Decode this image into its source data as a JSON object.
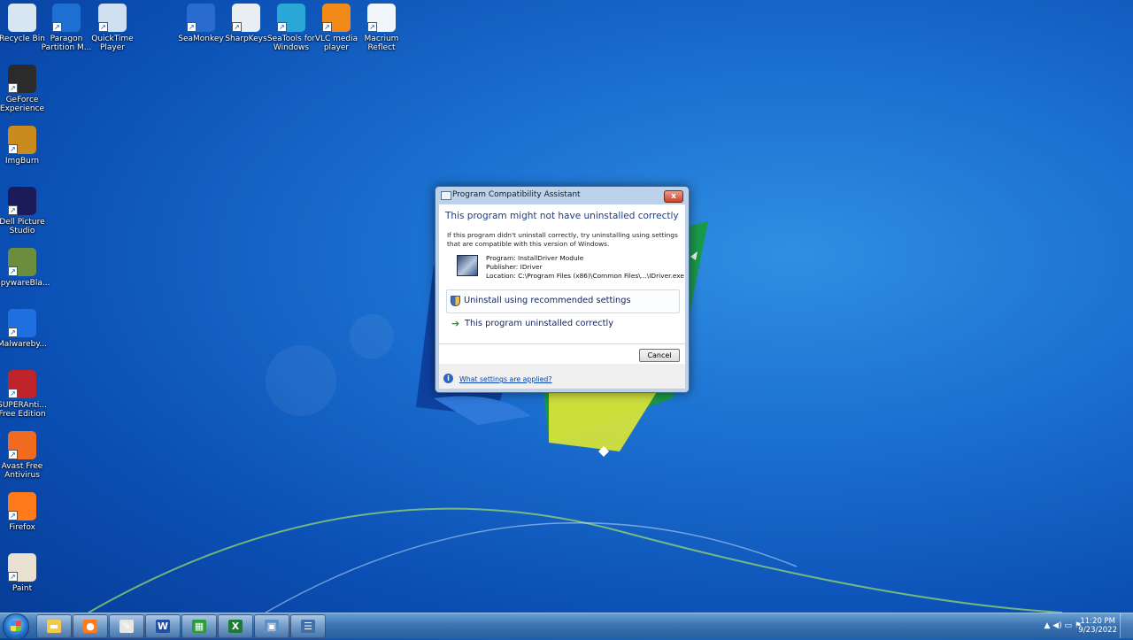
{
  "desktop": {
    "icons": [
      {
        "label": "Recycle Bin",
        "icon": "recycle-bin-icon"
      },
      {
        "label": "Paragon Partition M...",
        "icon": "paragon-icon"
      },
      {
        "label": "QuickTime Player",
        "icon": "quicktime-icon"
      },
      {
        "label": "SeaMonkey",
        "icon": "seamonkey-icon"
      },
      {
        "label": "SharpKeys",
        "icon": "sharpkeys-icon"
      },
      {
        "label": "SeaTools for Windows",
        "icon": "seatools-icon"
      },
      {
        "label": "VLC media player",
        "icon": "vlc-icon"
      },
      {
        "label": "Macrium Reflect",
        "icon": "macrium-icon"
      },
      {
        "label": "GeForce Experience",
        "icon": "geforce-icon"
      },
      {
        "label": "ImgBurn",
        "icon": "imgburn-icon"
      },
      {
        "label": "Dell Picture Studio",
        "icon": "dell-picture-studio-icon"
      },
      {
        "label": "SpywareBla...",
        "icon": "spywareblaster-icon"
      },
      {
        "label": "Malwareby...",
        "icon": "malwarebytes-icon"
      },
      {
        "label": "SUPERAnti... Free Edition",
        "icon": "superantispyware-icon"
      },
      {
        "label": "Avast Free Antivirus",
        "icon": "avast-icon"
      },
      {
        "label": "Firefox",
        "icon": "firefox-icon"
      },
      {
        "label": "Paint",
        "icon": "paint-icon"
      }
    ]
  },
  "dialog": {
    "title": "Program Compatibility Assistant",
    "close_glyph": "x",
    "heading": "This program might not have uninstalled correctly",
    "description": "If this program didn't uninstall correctly, try uninstalling using settings that are compatible with this version of Windows.",
    "program": "Program: InstallDriver Module",
    "publisher": "Publisher: IDriver",
    "location": "Location: C:\\Program Files (x86)\\Common Files\\...\\IDriver.exe",
    "option_recommended": "Uninstall using recommended settings",
    "option_correct": "This program uninstalled correctly",
    "cancel_label": "Cancel",
    "info_glyph": "i",
    "settings_link": "What settings are applied?"
  },
  "taskbar": {
    "pinned": [
      {
        "icon": "explorer-icon",
        "glyph": "▬",
        "color": "#f2c94c"
      },
      {
        "icon": "firefox-icon",
        "glyph": "●",
        "color": "#ff7a1a"
      },
      {
        "icon": "paint-icon",
        "glyph": "✎",
        "color": "#e6e6e6"
      },
      {
        "icon": "word-icon",
        "glyph": "W",
        "color": "#1f4fa3"
      },
      {
        "icon": "windows-update-icon",
        "glyph": "▦",
        "color": "#2a9d3a"
      },
      {
        "icon": "excel-icon",
        "glyph": "X",
        "color": "#1e7b34"
      },
      {
        "icon": "remote-desktop-icon",
        "glyph": "▣",
        "color": "#5d8fc9"
      },
      {
        "icon": "list-app-icon",
        "glyph": "☰",
        "color": "#3f6fa8"
      }
    ],
    "tray_glyphs": "▲ ◀) ▭ ⚑",
    "time": "11:20 PM",
    "date": "9/23/2022"
  },
  "colors": {
    "desktop_blue": "#1b6fd0",
    "dialog_heading": "#1e3c84",
    "link": "#0645ad",
    "close_red": "#c7432a"
  }
}
